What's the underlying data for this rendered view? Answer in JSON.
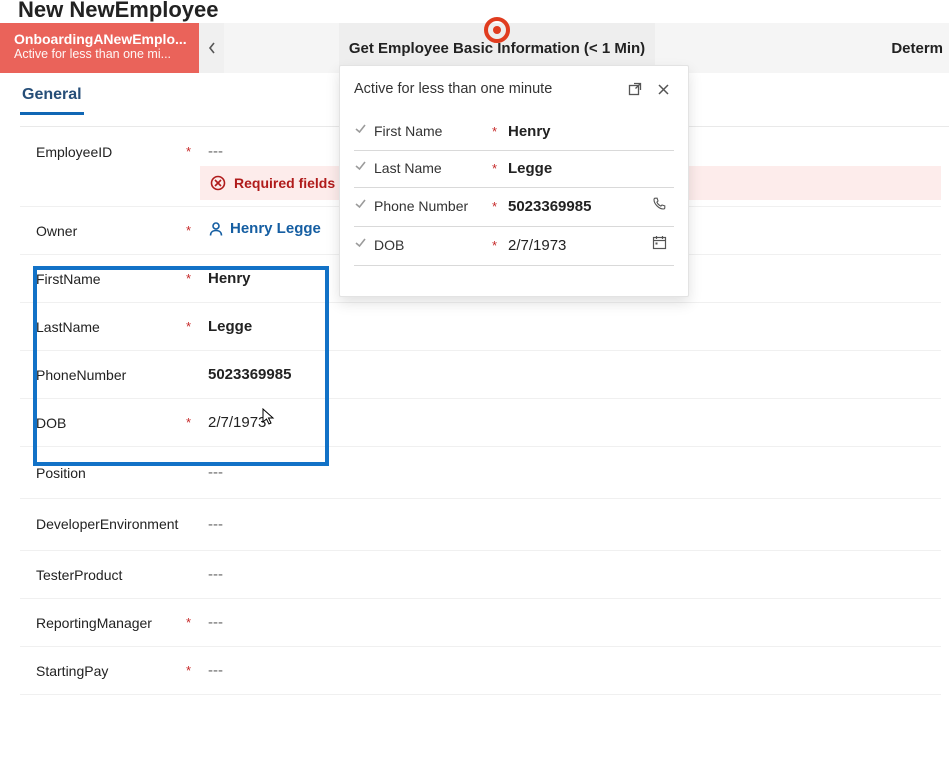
{
  "page": {
    "title": "New NewEmployee"
  },
  "process": {
    "stage1_title": "OnboardingANewEmplo...",
    "stage1_sub": "Active for less than one mi...",
    "stage2_label": "Get Employee Basic Information  (< 1 Min)",
    "stage_right": "Determ"
  },
  "tabs": {
    "general": "General"
  },
  "fields": {
    "employeeid_label": "EmployeeID",
    "employeeid_value": "---",
    "error_text": "Required fields",
    "owner_label": "Owner",
    "owner_value": "Henry Legge",
    "firstname_label": "FirstName",
    "firstname_value": "Henry",
    "lastname_label": "LastName",
    "lastname_value": "Legge",
    "phone_label": "PhoneNumber",
    "phone_value": "5023369985",
    "dob_label": "DOB",
    "dob_value": "2/7/1973",
    "position_label": "Position",
    "position_value": "---",
    "devenv_label": "DeveloperEnvironment",
    "devenv_value": "---",
    "tester_label": "TesterProduct",
    "tester_value": "---",
    "manager_label": "ReportingManager",
    "manager_value": "---",
    "pay_label": "StartingPay",
    "pay_value": "---"
  },
  "panel": {
    "header": "Active for less than one minute",
    "first_label": "First Name",
    "first_value": "Henry",
    "last_label": "Last Name",
    "last_value": "Legge",
    "phone_label": "Phone Number",
    "phone_value": "5023369985",
    "dob_label": "DOB",
    "dob_value": "2/7/1973"
  }
}
